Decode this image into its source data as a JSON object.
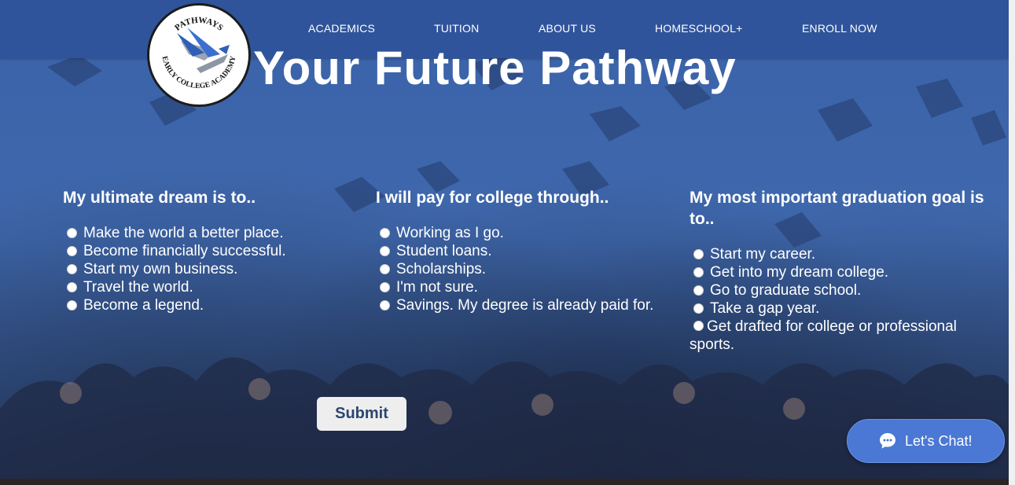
{
  "header": {
    "logo_top_text": "PATHWAYS",
    "logo_bottom_text": "EARLY COLLEGE ACADEMY",
    "nav": [
      {
        "label": "ACADEMICS"
      },
      {
        "label": "TUITION"
      },
      {
        "label": "ABOUT US"
      },
      {
        "label": "HOMESCHOOL+"
      },
      {
        "label": "ENROLL NOW"
      }
    ]
  },
  "hero": {
    "title": "Your Future Pathway"
  },
  "questions": [
    {
      "heading": "My ultimate dream is to..",
      "options": [
        "Make the world a better place.",
        "Become financially successful.",
        "Start my own business.",
        "Travel the world.",
        "Become a legend."
      ]
    },
    {
      "heading": "I will pay for college through..",
      "options": [
        "Working as I go.",
        "Student loans.",
        "Scholarships.",
        "I'm not sure.",
        "Savings. My degree is already paid for."
      ]
    },
    {
      "heading": "My most important graduation goal is to..",
      "options": [
        "Start my career.",
        "Get into my dream college.",
        "Go to graduate school.",
        "Take a gap year.",
        "Get drafted for college or professional sports."
      ]
    }
  ],
  "form": {
    "submit_label": "Submit"
  },
  "chat": {
    "label": "Let's Chat!"
  },
  "colors": {
    "header_bg": "#30549b",
    "hero_bg": "#3f68ad",
    "chat_bg": "#4a78d4",
    "submit_text": "#2c4570"
  }
}
